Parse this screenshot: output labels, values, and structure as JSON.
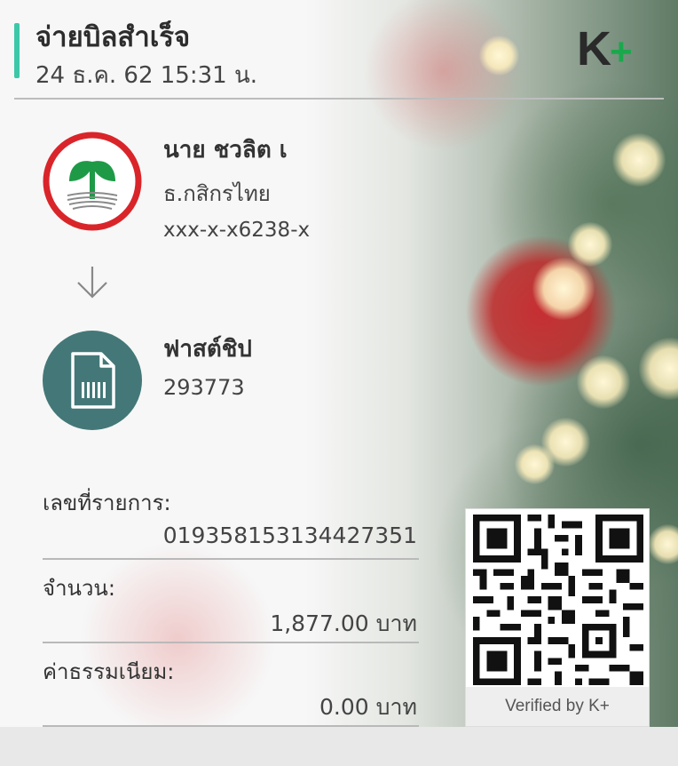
{
  "header": {
    "title": "จ่ายบิลสำเร็จ",
    "datetime": "24 ธ.ค. 62  15:31 น.",
    "brand_main": "K",
    "brand_plus": "+"
  },
  "sender": {
    "name": "นาย ชวลิต เ",
    "bank": "ธ.กสิกรไทย",
    "account": "xxx-x-x6238-x"
  },
  "receiver": {
    "name": "ฟาสต์ชิป",
    "code": "293773"
  },
  "transaction": {
    "ref_label": "เลขที่รายการ:",
    "ref_value": "019358153134427351",
    "amount_label": "จำนวน:",
    "amount_value": "1,877.00 บาท",
    "fee_label": "ค่าธรรมเนียม:",
    "fee_value": "0.00 บาท"
  },
  "qr": {
    "verified_text": "Verified by K+"
  },
  "colors": {
    "accent": "#3cc8a8",
    "brand_plus": "#1aa84c",
    "kbank_green": "#1e9a47",
    "kbank_red": "#d9252a",
    "bill_icon_bg": "#447878"
  }
}
